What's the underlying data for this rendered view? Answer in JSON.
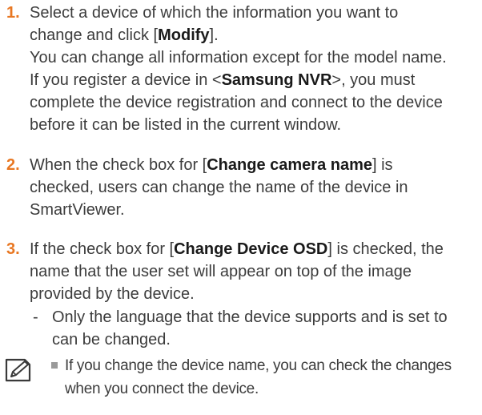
{
  "steps": [
    {
      "number": "1.",
      "lines": [
        {
          "parts": [
            {
              "t": "Select a device of which the information you want to"
            }
          ]
        },
        {
          "parts": [
            {
              "t": "change and click ["
            },
            {
              "t": "Modify",
              "b": true
            },
            {
              "t": "]."
            }
          ]
        },
        {
          "parts": [
            {
              "t": "You can change all information except for the model name."
            }
          ]
        },
        {
          "parts": [
            {
              "t": "If you register a device in <"
            },
            {
              "t": "Samsung NVR",
              "b": true
            },
            {
              "t": ">, you must"
            }
          ]
        },
        {
          "parts": [
            {
              "t": "complete the device registration and connect to the device"
            }
          ]
        },
        {
          "parts": [
            {
              "t": "before it can be listed in the current window."
            }
          ]
        }
      ]
    },
    {
      "number": "2.",
      "lines": [
        {
          "parts": [
            {
              "t": "When the check box for ["
            },
            {
              "t": "Change camera name",
              "b": true
            },
            {
              "t": "] is"
            }
          ]
        },
        {
          "parts": [
            {
              "t": "checked, users can change the name of the device in"
            }
          ]
        },
        {
          "parts": [
            {
              "t": "SmartViewer."
            }
          ]
        }
      ]
    },
    {
      "number": "3.",
      "lines": [
        {
          "parts": [
            {
              "t": "If the check box for ["
            },
            {
              "t": "Change Device OSD",
              "b": true
            },
            {
              "t": "] is checked, the"
            }
          ]
        },
        {
          "parts": [
            {
              "t": "name that the user set will appear on top of the image"
            }
          ]
        },
        {
          "parts": [
            {
              "t": "provided by the device."
            }
          ]
        }
      ]
    }
  ],
  "subitem": {
    "dash": "-",
    "lines": [
      "Only the language that the device supports and is set to",
      "can be changed."
    ]
  },
  "note": {
    "icon": "note-pencil-icon",
    "lines": [
      "If you change the device name, you can check the changes",
      "when you connect the device."
    ]
  },
  "colors": {
    "step_number": "#e87722",
    "text": "#3c3c3c",
    "bullet": "#9a9a9a"
  }
}
